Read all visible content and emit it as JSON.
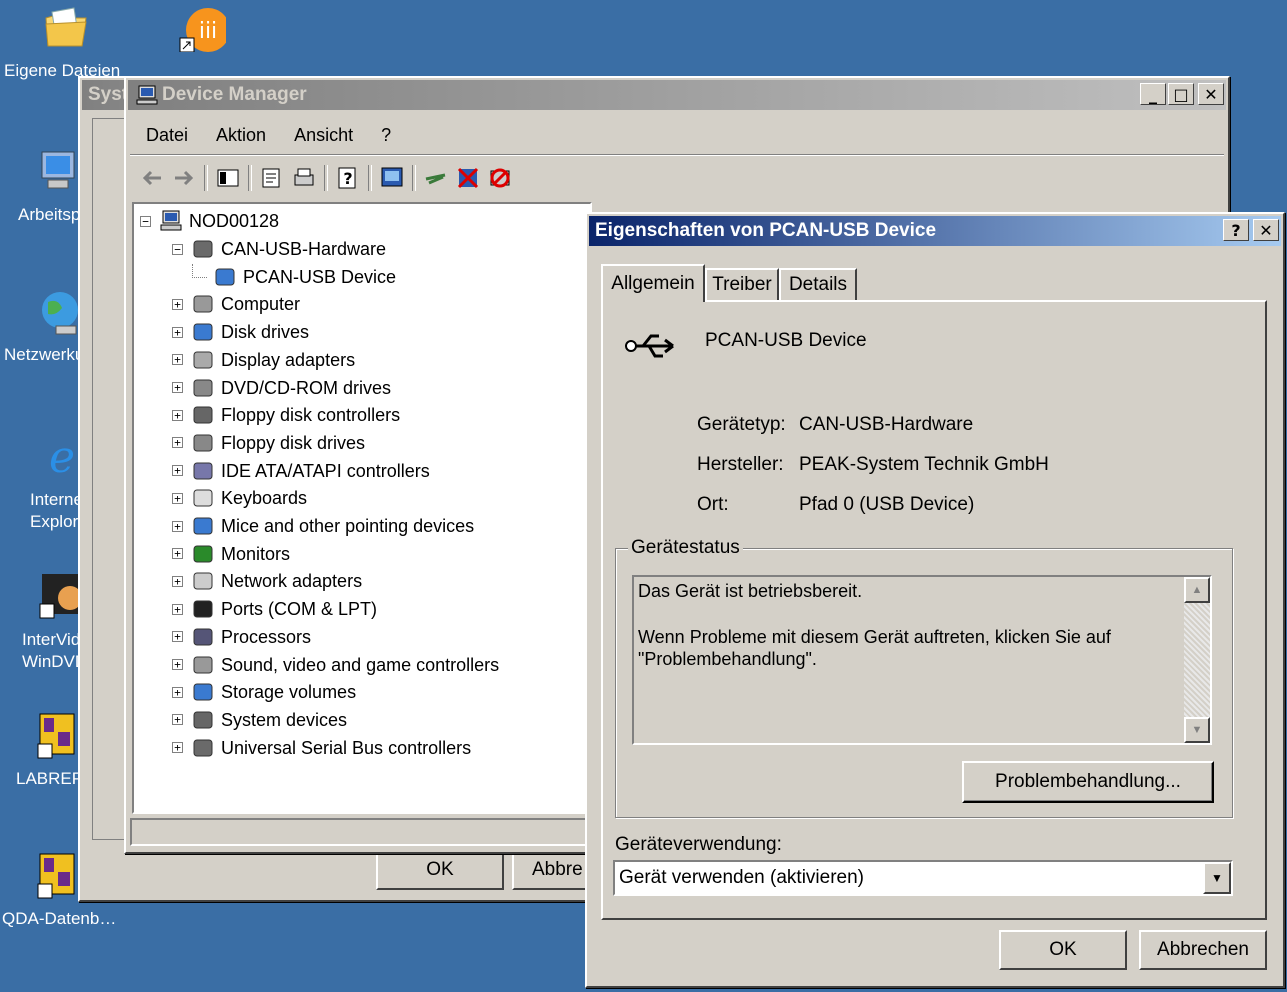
{
  "desktop": {
    "icons": [
      {
        "label": "Eigene Dateien"
      },
      {
        "label": "Arbeitsplatz"
      },
      {
        "label": "Netzwerkumgebung"
      },
      {
        "label": "Internet Explorer"
      },
      {
        "label": "InterVideo WinDVD"
      },
      {
        "label": "LABREP"
      },
      {
        "label": "QDA-Datenb…"
      }
    ],
    "icon_partial_label": "Eigene Dateien"
  },
  "system_props": {
    "title": "Syst",
    "ok_label": "OK",
    "cancel_label": "Abbre"
  },
  "device_manager": {
    "title": "Device Manager",
    "menu": [
      "Datei",
      "Aktion",
      "Ansicht",
      "?"
    ],
    "tree": {
      "root": "NOD00128",
      "items": [
        {
          "label": "CAN-USB-Hardware",
          "expanded": true,
          "level": 1
        },
        {
          "label": "PCAN-USB Device",
          "level": 2
        },
        {
          "label": "Computer",
          "level": 1
        },
        {
          "label": "Disk drives",
          "level": 1
        },
        {
          "label": "Display adapters",
          "level": 1
        },
        {
          "label": "DVD/CD-ROM drives",
          "level": 1
        },
        {
          "label": "Floppy disk controllers",
          "level": 1
        },
        {
          "label": "Floppy disk drives",
          "level": 1
        },
        {
          "label": "IDE ATA/ATAPI controllers",
          "level": 1
        },
        {
          "label": "Keyboards",
          "level": 1
        },
        {
          "label": "Mice and other pointing devices",
          "level": 1
        },
        {
          "label": "Monitors",
          "level": 1
        },
        {
          "label": "Network adapters",
          "level": 1
        },
        {
          "label": "Ports (COM & LPT)",
          "level": 1
        },
        {
          "label": "Processors",
          "level": 1
        },
        {
          "label": "Sound, video and game controllers",
          "level": 1
        },
        {
          "label": "Storage volumes",
          "level": 1
        },
        {
          "label": "System devices",
          "level": 1
        },
        {
          "label": "Universal Serial Bus controllers",
          "level": 1
        }
      ]
    }
  },
  "props_dialog": {
    "title": "Eigenschaften von PCAN-USB Device",
    "tabs": [
      "Allgemein",
      "Treiber",
      "Details"
    ],
    "device_name": "PCAN-USB Device",
    "fields": {
      "type_label": "Gerätetyp:",
      "type_value": "CAN-USB-Hardware",
      "vendor_label": "Hersteller:",
      "vendor_value": "PEAK-System Technik GmbH",
      "location_label": "Ort:",
      "location_value": "Pfad 0 (USB Device)"
    },
    "status_group": "Gerätestatus",
    "status_line1": "Das Gerät ist betriebsbereit.",
    "status_line2": "Wenn Probleme mit diesem Gerät auftreten, klicken Sie auf",
    "status_line3": "\"Problembehandlung\".",
    "troubleshoot_label": "Problembehandlung...",
    "usage_label": "Geräteverwendung:",
    "usage_value": "Gerät verwenden (aktivieren)",
    "ok_label": "OK",
    "cancel_label": "Abbrechen"
  }
}
